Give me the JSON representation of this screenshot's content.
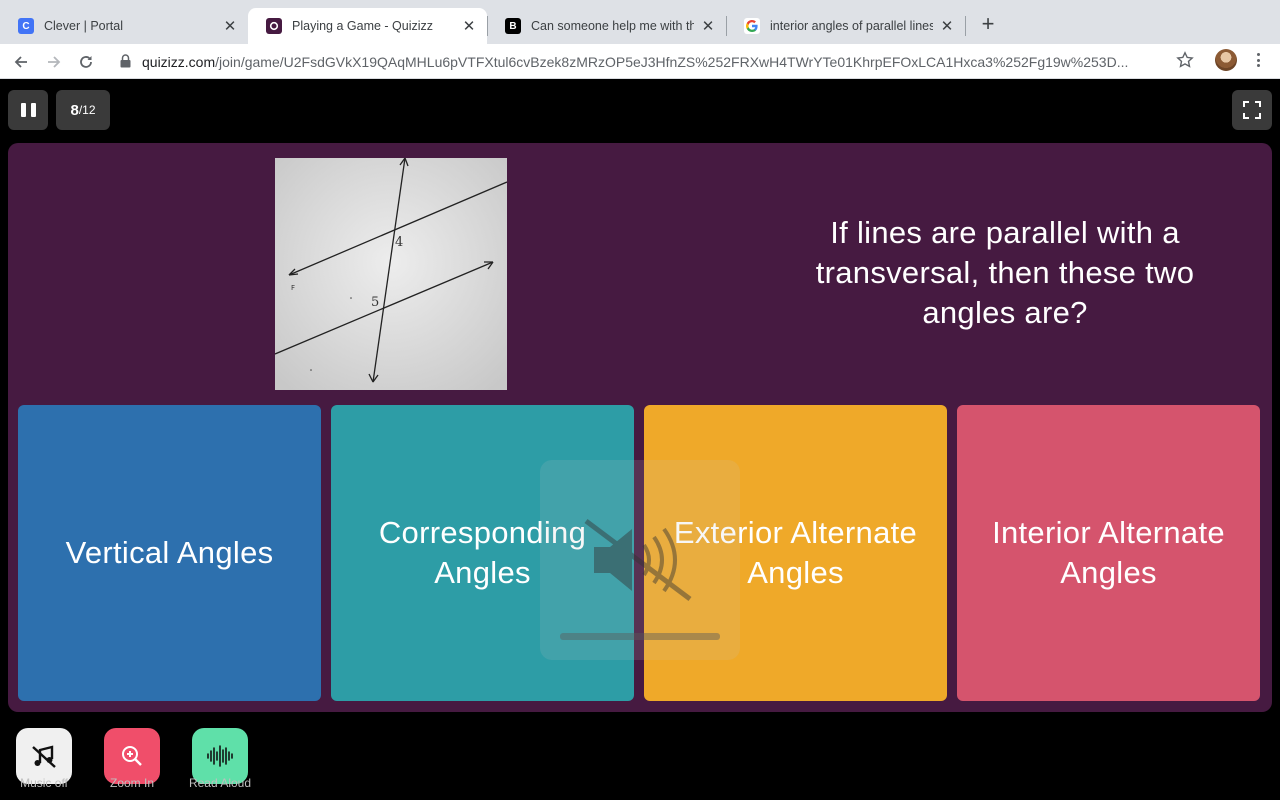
{
  "browser": {
    "tabs": [
      {
        "title": "Clever | Portal",
        "favicon": "clever-icon",
        "active": false
      },
      {
        "title": "Playing a Game - Quizizz",
        "favicon": "quizizz-icon",
        "active": true
      },
      {
        "title": "Can someone help me with this",
        "favicon": "brainly-icon",
        "active": false
      },
      {
        "title": "interior angles of parallel lines",
        "favicon": "google-icon",
        "active": false
      }
    ],
    "url_host": "quizizz.com",
    "url_path": "/join/game/U2FsdGVkX19QAqMHLu6pVTFXtul6cvBzek8zMRzOP5eJ3HfnZS%252FRXwH4TWrYTe01KhrpEFOxLCA1Hxca3%252Fg19w%253D..."
  },
  "game": {
    "progress_current": "8",
    "progress_total": "/12",
    "question": "If lines are parallel with a transversal, then these two angles are?",
    "image_labels": {
      "angle_top": "4",
      "angle_bottom": "5",
      "point": "F"
    },
    "options": [
      {
        "label": "Vertical Angles",
        "color": "#2d70ae"
      },
      {
        "label": "Corresponding Angles",
        "color": "#2d9da6"
      },
      {
        "label": "Exterior Alternate Angles",
        "color": "#efa929"
      },
      {
        "label": "Interior Alternate Angles",
        "color": "#d5546d"
      }
    ],
    "background_color": "#461a41"
  },
  "dock": {
    "music": {
      "label": "Music off",
      "icon": "music-off-icon"
    },
    "zoom": {
      "label": "Zoom In",
      "icon": "zoom-in-icon"
    },
    "read_aloud": {
      "label": "Read Aloud",
      "icon": "sound-wave-icon"
    }
  }
}
